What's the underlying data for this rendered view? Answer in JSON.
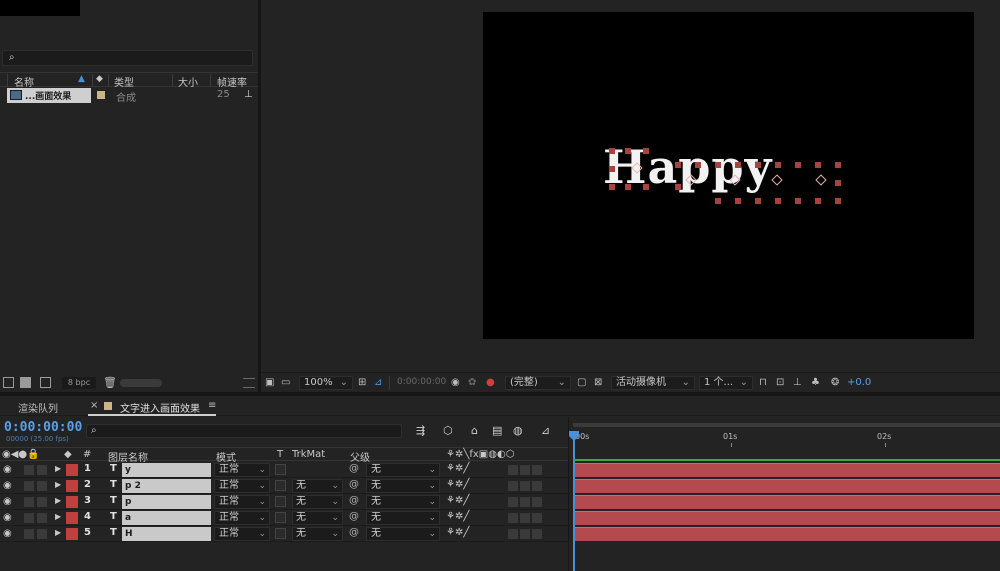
{
  "project": {
    "search_icon": "⌕",
    "columns": {
      "name": "名称",
      "type": "类型",
      "size": "大小",
      "fps": "帧速率"
    },
    "items": [
      {
        "name": "...画面效果",
        "type": "合成",
        "fps": "25"
      }
    ],
    "bpc": "8 bpc"
  },
  "viewer": {
    "text": "Happy",
    "zoom": "100%",
    "timecode": "0:00:00:00",
    "resolution": "(完整)",
    "camera": "活动摄像机",
    "views": "1 个...",
    "exposure": "+0.0"
  },
  "tabs": {
    "render_queue": "渲染队列",
    "comp": "文字进入画面效果",
    "menu_icon": "≡",
    "close": "×"
  },
  "timeline": {
    "timecode": "0:00:00:00",
    "frame_info": "00000 (25.00 fps)",
    "columns": {
      "num": "#",
      "layer_name": "图层名称",
      "mode": "模式",
      "t": "T",
      "trkmat": "TrkMat",
      "parent": "父级"
    },
    "ruler": [
      "00s",
      "01s",
      "02s"
    ],
    "layers": [
      {
        "num": "1",
        "type": "T",
        "name": "y",
        "mode": "正常",
        "trkmat": "",
        "parent": "无"
      },
      {
        "num": "2",
        "type": "T",
        "name": "p 2",
        "mode": "正常",
        "trkmat": "无",
        "parent": "无"
      },
      {
        "num": "3",
        "type": "T",
        "name": "p",
        "mode": "正常",
        "trkmat": "无",
        "parent": "无"
      },
      {
        "num": "4",
        "type": "T",
        "name": "a",
        "mode": "正常",
        "trkmat": "无",
        "parent": "无"
      },
      {
        "num": "5",
        "type": "T",
        "name": "H",
        "mode": "正常",
        "trkmat": "无",
        "parent": "无"
      }
    ]
  },
  "colors": {
    "accent": "#4a90d9",
    "layer_label": "#c04040",
    "layer_bar": "#b44a4d"
  }
}
